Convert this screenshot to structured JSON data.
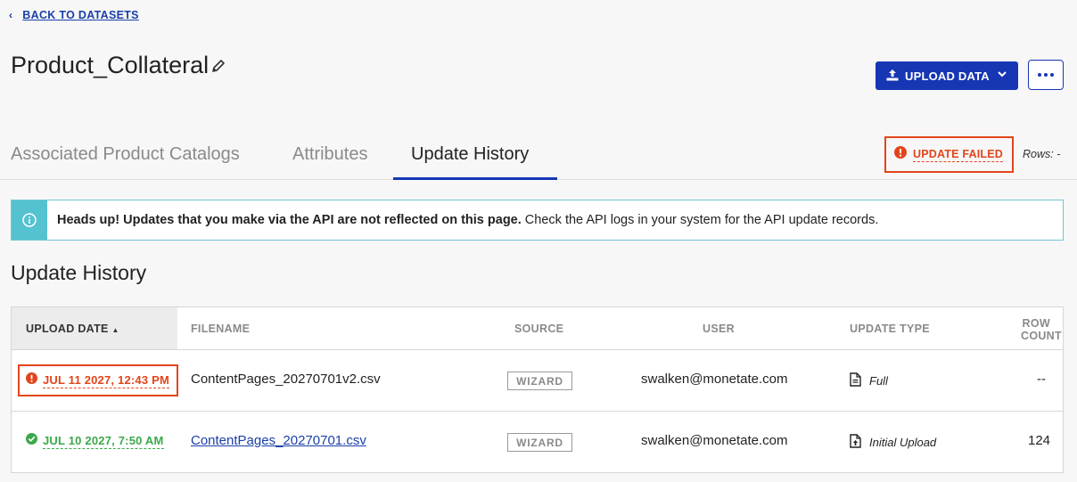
{
  "nav": {
    "back_label": "BACK TO DATASETS"
  },
  "dataset": {
    "title": "Product_Collateral"
  },
  "actions": {
    "upload_label": "UPLOAD DATA"
  },
  "tabs": [
    {
      "label": "Associated Product Catalogs"
    },
    {
      "label": "Attributes"
    },
    {
      "label": "Update History",
      "active": true
    }
  ],
  "status": {
    "label": "UPDATE FAILED",
    "rows_text": "Rows: -"
  },
  "alert": {
    "bold_text": "Heads up! Updates that you make via the API are not reflected on this page.",
    "text": " Check the API logs in your system for the API update records."
  },
  "section": {
    "title": "Update History"
  },
  "table": {
    "headers": {
      "upload_date": "UPLOAD DATE",
      "filename": "FILENAME",
      "source": "SOURCE",
      "user": "USER",
      "update_type": "UPDATE TYPE",
      "row_count_1": "ROW",
      "row_count_2": "COUNT"
    },
    "rows": [
      {
        "date": "JUL 11 2027, 12:43 PM",
        "status": "failed",
        "filename": "ContentPages_20270701v2.csv",
        "source": "WIZARD",
        "user": "swalken@monetate.com",
        "update_type": "Full",
        "row_count": "--"
      },
      {
        "date": "JUL 10 2027, 7:50 AM",
        "status": "success",
        "filename": "ContentPages_20270701.csv",
        "source": "WIZARD",
        "user": "swalken@monetate.com",
        "update_type": "Initial Upload",
        "row_count": "124"
      }
    ]
  },
  "colors": {
    "accent": "#1636b4",
    "error": "#e2451b",
    "success": "#3ba84a",
    "info": "#55c2d0"
  }
}
